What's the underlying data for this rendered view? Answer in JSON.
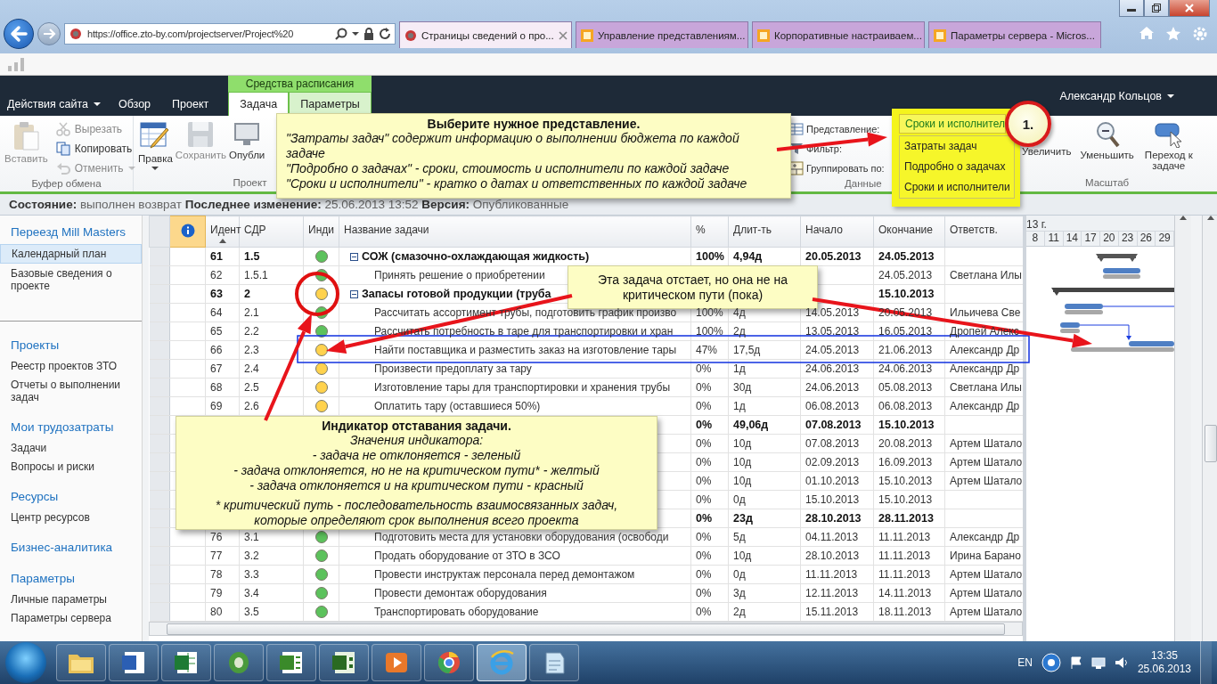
{
  "browser": {
    "url": "https://office.zto-by.com/projectserver/Project%20",
    "tabs": [
      {
        "title": "Страницы сведений о про...",
        "selected": true
      },
      {
        "title": "Управление представлениям...",
        "selected": false
      },
      {
        "title": "Корпоративные настраиваем...",
        "selected": false
      },
      {
        "title": "Параметры сервера - Micros...",
        "selected": false
      }
    ]
  },
  "ribbon": {
    "site_actions": "Действия сайта",
    "context_label": "Средства расписания",
    "user": "Александр Кольцов",
    "tabs": [
      {
        "label": "Обзор",
        "selected": false,
        "contextual": false
      },
      {
        "label": "Проект",
        "selected": false,
        "contextual": false
      },
      {
        "label": "Задача",
        "selected": true,
        "contextual": true
      },
      {
        "label": "Параметры",
        "selected": false,
        "contextual": true
      }
    ],
    "clipboard": {
      "label": "Буфер обмена",
      "paste": {
        "label": "Вставить",
        "disabled": true
      },
      "cut": {
        "label": "Вырезать",
        "disabled": true
      },
      "copy": {
        "label": "Копировать",
        "disabled": false
      },
      "undo": {
        "label": "Отменить",
        "disabled": true
      }
    },
    "project": {
      "label": "Проект",
      "edit": {
        "label": "Правка",
        "disabled": false
      },
      "save": {
        "label": "Сохранить",
        "disabled": true
      },
      "publish": {
        "label": "Опубли",
        "disabled": false
      }
    },
    "data": {
      "label": "Данные",
      "view_label": "Представление:",
      "filter_label": "Фильтр:",
      "group_label": "Группировать по:",
      "view_value": "Сроки и исполнител",
      "view_options": [
        "Затраты задач",
        "Подробно о задачах",
        "Сроки и исполнители"
      ]
    },
    "zoom": {
      "label": "Масштаб",
      "zoom_in": "Увеличить",
      "zoom_out": "Уменьшить",
      "goto": "Переход к задаче"
    }
  },
  "status_bar": "**Состояние:** выполнен возврат **Последнее изменение:** 25.06.2013 13:52 **Версия:** Опубликованные",
  "sidebar": {
    "sections": [
      {
        "heading": "Переезд Mill Masters",
        "items": [
          {
            "label": "Календарный план",
            "selected": true
          },
          {
            "label": "Базовые сведения о проекте",
            "selected": false
          }
        ]
      },
      {
        "heading": "Проекты",
        "items": [
          {
            "label": "Реестр проектов ЗТО",
            "selected": false
          },
          {
            "label": "Отчеты о выполнении задач",
            "selected": false
          }
        ]
      },
      {
        "heading": "Мои трудозатраты",
        "items": [
          {
            "label": "Задачи",
            "selected": false
          },
          {
            "label": "Вопросы и риски",
            "selected": false
          }
        ]
      },
      {
        "heading": "Ресурсы",
        "items": [
          {
            "label": "Центр ресурсов",
            "selected": false
          }
        ]
      },
      {
        "heading": "Бизнес-аналитика"
      },
      {
        "heading": "Параметры",
        "items": [
          {
            "label": "Личные параметры",
            "selected": false
          },
          {
            "label": "Параметры сервера",
            "selected": false
          }
        ]
      }
    ]
  },
  "table": {
    "columns": [
      {
        "label": "Идент",
        "sorted": true
      },
      {
        "label": "СДР",
        "sorted": false
      },
      {
        "label": "Инди",
        "sorted": false
      },
      {
        "label": "Название задачи",
        "sorted": false
      },
      {
        "label": "%",
        "sorted": false
      },
      {
        "label": "Длит-ть",
        "sorted": false
      },
      {
        "label": "Начало",
        "sorted": false
      },
      {
        "label": "Окончание",
        "sorted": false
      },
      {
        "label": "Ответств.",
        "sorted": false
      }
    ],
    "rows": [
      {
        "id": "61",
        "wbs": "1.5",
        "color": "#5cc25c",
        "name": "СОЖ (смазочно-охлаждающая жидкость)",
        "pct": "100%",
        "duration": "4,94д",
        "start": "20.05.2013",
        "finish": "24.05.2013",
        "summary": true,
        "expanded": true,
        "children": [
          {
            "id": "62",
            "wbs": "1.5.1",
            "color": "#5cc25c",
            "name": "Принять решение о приобретении",
            "finish": "24.05.2013",
            "owner": "Светлана Илы",
            "summary": false
          }
        ]
      },
      {
        "id": "63",
        "wbs": "2",
        "color": "#ffd24d",
        "name": "Запасы готовой продукции (труба",
        "finish": "15.10.2013",
        "summary": true,
        "expanded": true,
        "children": [
          {
            "id": "64",
            "wbs": "2.1",
            "color": "#5cc25c",
            "name": "Рассчитать ассортимент трубы, подготовить график произво",
            "pct": "100%",
            "duration": "4д",
            "start": "14.05.2013",
            "finish": "20.05.2013",
            "owner": "Ильичева Све",
            "summary": false
          },
          {
            "id": "65",
            "wbs": "2.2",
            "color": "#5cc25c",
            "name": "Рассчитать потребность в таре для транспортировки и хран",
            "pct": "100%",
            "duration": "2д",
            "start": "13.05.2013",
            "finish": "16.05.2013",
            "owner": "Дропей Алекс",
            "summary": false
          },
          {
            "id": "66",
            "wbs": "2.3",
            "color": "#ffd24d",
            "name": "Найти поставщика и разместить заказ на изготовление тары",
            "pct": "47%",
            "duration": "17,5д",
            "start": "24.05.2013",
            "finish": "21.06.2013",
            "owner": "Александр Др",
            "summary": false
          },
          {
            "id": "67",
            "wbs": "2.4",
            "color": "#ffd24d",
            "name": "Произвести предоплату за тару",
            "pct": "0%",
            "duration": "1д",
            "start": "24.06.2013",
            "finish": "24.06.2013",
            "owner": "Александр Др",
            "summary": false
          },
          {
            "id": "68",
            "wbs": "2.5",
            "color": "#ffd24d",
            "name": "Изготовление тары для транспортировки и хранения трубы",
            "pct": "0%",
            "duration": "30д",
            "start": "24.06.2013",
            "finish": "05.08.2013",
            "owner": "Светлана Илы",
            "summary": false
          },
          {
            "id": "69",
            "wbs": "2.6",
            "color": "#ffd24d",
            "name": "Оплатить тару (оставшиеся 50%)",
            "pct": "0%",
            "duration": "1д",
            "start": "06.08.2013",
            "finish": "06.08.2013",
            "owner": "Александр Др",
            "summary": false
          },
          {
            "pct": "0%",
            "duration": "49,06д",
            "start": "07.08.2013",
            "finish": "15.10.2013",
            "summary": true,
            "children": [
              {
                "pct": "0%",
                "duration": "10д",
                "start": "07.08.2013",
                "finish": "20.08.2013",
                "owner": "Артем Шатало",
                "summary": false
              },
              {
                "pct": "0%",
                "duration": "10д",
                "start": "02.09.2013",
                "finish": "16.09.2013",
                "owner": "Артем Шатало",
                "summary": false
              },
              {
                "pct": "0%",
                "duration": "10д",
                "start": "01.10.2013",
                "finish": "15.10.2013",
                "owner": "Артем Шатало",
                "summary": false
              },
              {
                "pct": "0%",
                "duration": "0д",
                "start": "15.10.2013",
                "finish": "15.10.2013",
                "summary": false
              }
            ]
          }
        ]
      },
      {
        "pct": "0%",
        "duration": "23д",
        "start": "28.10.2013",
        "finish": "28.11.2013",
        "summary": true,
        "children": [
          {
            "id": "76",
            "wbs": "3.1",
            "color": "#5cc25c",
            "name": "Подготовить места для установки оборудования (освободи",
            "pct": "0%",
            "duration": "5д",
            "start": "04.11.2013",
            "finish": "11.11.2013",
            "owner": "Александр Др",
            "summary": false
          },
          {
            "id": "77",
            "wbs": "3.2",
            "color": "#5cc25c",
            "name": "Продать оборудование от ЗТО в ЗСО",
            "pct": "0%",
            "duration": "10д",
            "start": "28.10.2013",
            "finish": "11.11.2013",
            "owner": "Ирина Барано",
            "summary": false
          },
          {
            "id": "78",
            "wbs": "3.3",
            "color": "#5cc25c",
            "name": "Провести инструктаж персонала перед демонтажом",
            "pct": "0%",
            "duration": "0д",
            "start": "11.11.2013",
            "finish": "11.11.2013",
            "owner": "Артем Шатало",
            "summary": false
          },
          {
            "id": "79",
            "wbs": "3.4",
            "color": "#5cc25c",
            "name": "Провести демонтаж оборудования",
            "pct": "0%",
            "duration": "3д",
            "start": "12.11.2013",
            "finish": "14.11.2013",
            "owner": "Артем Шатало",
            "summary": false
          },
          {
            "id": "80",
            "wbs": "3.5",
            "color": "#5cc25c",
            "name": "Транспортировать оборудование",
            "pct": "0%",
            "duration": "2д",
            "start": "15.11.2013",
            "finish": "18.11.2013",
            "owner": "Артем Шатало",
            "summary": false
          }
        ]
      }
    ]
  },
  "gantt": {
    "period": "13 г.",
    "days": [
      "8",
      "11",
      "14",
      "17",
      "20",
      "23",
      "26",
      "29"
    ]
  },
  "view_callout": {
    "title": "Выберите нужное представление.",
    "lines": [
      "\"Затраты задач\" содержит информацию о выполнении бюджета по каждой задаче",
      "\"Подробно о задачах\" - сроки, стоимость и исполнители по каждой задаче",
      "\"Сроки и исполнители\" - кратко о датах и ответственных по каждой задаче"
    ]
  },
  "lag_callout": {
    "text": "Эта задача отстает, но она не на критическом пути (пока)"
  },
  "indicator_callout": {
    "title": "Индикатор отставания задачи.",
    "subtitle": "Значения индикатора:",
    "lines": [
      "- задача не отклоняется - зеленый",
      "- задача отклоняется, но не на критическом пути* - желтый",
      "- задача отклоняется и на критическом пути - красный"
    ],
    "note": "* критический путь - последовательность взаимосвязанных задач, которые определяют срок выполнения всего проекта"
  },
  "step_marker": "1.",
  "taskbar": {
    "apps": [
      {
        "selected": false
      },
      {
        "selected": false
      },
      {
        "selected": false
      },
      {
        "selected": false
      },
      {
        "selected": false
      },
      {
        "selected": false
      },
      {
        "selected": false
      },
      {
        "selected": false
      },
      {
        "selected": true
      },
      {
        "selected": false
      }
    ],
    "language": "EN",
    "time": "13:35",
    "date": "25.06.2013"
  }
}
